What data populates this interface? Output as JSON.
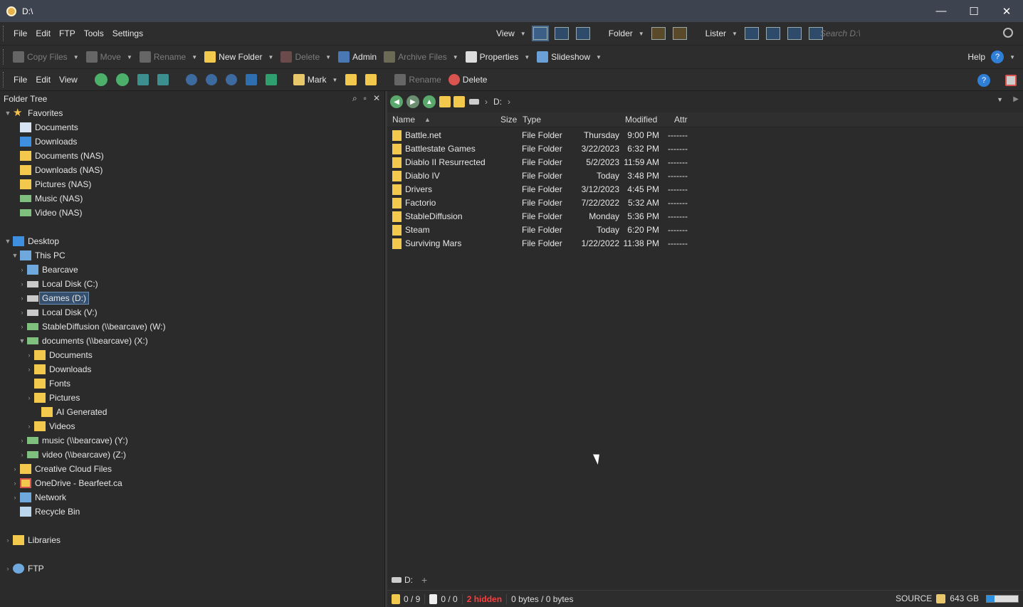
{
  "window": {
    "title": "D:\\",
    "minimize": "—",
    "maximize": "☐",
    "close": "✕"
  },
  "menubar": {
    "items": [
      "File",
      "Edit",
      "FTP",
      "Tools",
      "Settings"
    ],
    "view_label": "View",
    "folder_label": "Folder",
    "lister_label": "Lister",
    "search_placeholder": "Search D:\\"
  },
  "toolbar": {
    "copy_files": "Copy Files",
    "move": "Move",
    "rename": "Rename",
    "new_folder": "New Folder",
    "delete": "Delete",
    "admin": "Admin",
    "archive_files": "Archive Files",
    "properties": "Properties",
    "slideshow": "Slideshow",
    "help": "Help"
  },
  "toolbar2": {
    "menus": [
      "File",
      "Edit",
      "View"
    ],
    "mark": "Mark",
    "rename": "Rename",
    "delete": "Delete"
  },
  "folder_tree": {
    "header": "Folder Tree",
    "nodes": [
      {
        "label": "Favorites"
      },
      {
        "label": "Documents"
      },
      {
        "label": "Downloads"
      },
      {
        "label": "Documents (NAS)"
      },
      {
        "label": "Downloads (NAS)"
      },
      {
        "label": "Pictures (NAS)"
      },
      {
        "label": "Music (NAS)"
      },
      {
        "label": "Video (NAS)"
      },
      {
        "label": "Desktop"
      },
      {
        "label": "This PC"
      },
      {
        "label": "Bearcave"
      },
      {
        "label": "Local Disk (C:)"
      },
      {
        "label": "Games (D:)"
      },
      {
        "label": "Local Disk (V:)"
      },
      {
        "label": "StableDiffusion (\\\\bearcave) (W:)"
      },
      {
        "label": "documents (\\\\bearcave) (X:)"
      },
      {
        "label": "Documents"
      },
      {
        "label": "Downloads"
      },
      {
        "label": "Fonts"
      },
      {
        "label": "Pictures"
      },
      {
        "label": "AI Generated"
      },
      {
        "label": "Videos"
      },
      {
        "label": "music (\\\\bearcave) (Y:)"
      },
      {
        "label": "video (\\\\bearcave) (Z:)"
      },
      {
        "label": "Creative Cloud Files"
      },
      {
        "label": "OneDrive - Bearfeet.ca"
      },
      {
        "label": "Network"
      },
      {
        "label": "Recycle Bin"
      },
      {
        "label": "Libraries"
      },
      {
        "label": "FTP"
      }
    ]
  },
  "lister": {
    "path": "D:",
    "columns": {
      "name": "Name",
      "size": "Size",
      "type": "Type",
      "modified": "Modified",
      "attr": "Attr"
    },
    "files": [
      {
        "name": "Battle.net",
        "type": "File Folder",
        "date": "Thursday",
        "time": "9:00 PM",
        "attr": "-------"
      },
      {
        "name": "Battlestate Games",
        "type": "File Folder",
        "date": "3/22/2023",
        "time": "6:32 PM",
        "attr": "-------"
      },
      {
        "name": "Diablo II Resurrected",
        "type": "File Folder",
        "date": "5/2/2023",
        "time": "11:59 AM",
        "attr": "-------"
      },
      {
        "name": "Diablo IV",
        "type": "File Folder",
        "date": "Today",
        "time": "3:48 PM",
        "attr": "-------"
      },
      {
        "name": "Drivers",
        "type": "File Folder",
        "date": "3/12/2023",
        "time": "4:45 PM",
        "attr": "-------"
      },
      {
        "name": "Factorio",
        "type": "File Folder",
        "date": "7/22/2022",
        "time": "5:32 AM",
        "attr": "-------"
      },
      {
        "name": "StableDiffusion",
        "type": "File Folder",
        "date": "Monday",
        "time": "5:36 PM",
        "attr": "-------"
      },
      {
        "name": "Steam",
        "type": "File Folder",
        "date": "Today",
        "time": "6:20 PM",
        "attr": "-------"
      },
      {
        "name": "Surviving Mars",
        "type": "File Folder",
        "date": "1/22/2022",
        "time": "11:38 PM",
        "attr": "-------"
      }
    ],
    "tab_label": "D:",
    "add_tab": "+"
  },
  "status": {
    "folders": "0 / 9",
    "files": "0 / 0",
    "hidden": "2 hidden",
    "bytes": "0 bytes / 0 bytes",
    "source": "SOURCE",
    "free": "643 GB",
    "free_fraction": 0.25
  }
}
